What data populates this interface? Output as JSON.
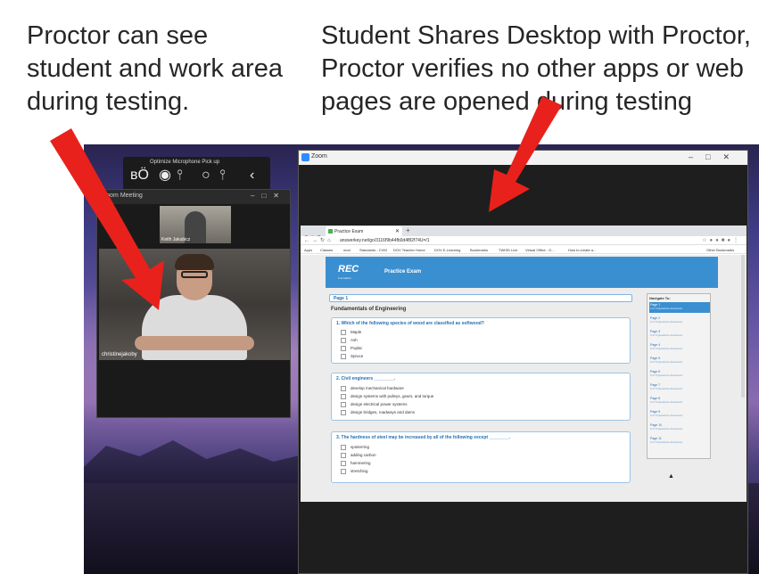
{
  "captions": {
    "left": "Proctor can see student and work area during testing.",
    "right": "Student Shares Desktop with Proctor, Proctor verifies no other apps or web pages are opened during testing"
  },
  "mic_toolbar": {
    "title": "Optimize Microphone Pick up"
  },
  "zoom_meeting": {
    "title": "Zoom Meeting",
    "thumbnail_name": "Keith Jakubicz",
    "participant_name": "christinejakoby"
  },
  "zoom_share": {
    "title": "Zoom"
  },
  "browser": {
    "tab_title": "Practice Exam",
    "url": "answerkey.net/go/3116f9b44fb0d4f82f74U=/1",
    "bookmarks": [
      "Apps",
      "Classes",
      "mod",
      "Standards - CVM",
      "DOV Teacher Home",
      "DOV E-Learning",
      "Bookmarks",
      "TWISD Live",
      "Virtual Office - G...",
      "How to create a...",
      "Other Bookmarks"
    ]
  },
  "exam": {
    "logo": "REC",
    "logo_sub": "Foundation",
    "header_title": "Practice Exam",
    "page_label": "Page 1",
    "section_title": "Fundamentals of Engineering",
    "questions": [
      {
        "text": "1.  Which of the following species of wood are classified as softwood?",
        "options": [
          "Maple",
          "Ash",
          "Poplar",
          "Spruce"
        ]
      },
      {
        "text": "2.  Civil engineers ________.",
        "options": [
          "develop mechanical hardware",
          "design systems with pulleys, gears, and torque",
          "design electrical power systems",
          "design bridges, roadways and dams"
        ]
      },
      {
        "text": "3.  The hardness of steel may be increased by all of the following except ________.",
        "options": [
          "spinterring",
          "adding carbon",
          "hammering",
          "stretching"
        ]
      }
    ],
    "navigate": {
      "heading": "Navigate To:",
      "pages": [
        {
          "label": "Page 1",
          "status": "0 of 5 Questions Answered"
        },
        {
          "label": "Page 2",
          "status": "0 of 5 Questions Answered"
        },
        {
          "label": "Page 3",
          "status": "0 of 4 Questions Answered"
        },
        {
          "label": "Page 4",
          "status": "0 of 5 Questions Answered"
        },
        {
          "label": "Page 5",
          "status": "0 of 5 Questions Answered"
        },
        {
          "label": "Page 6",
          "status": "0 of 5 Questions Answered"
        },
        {
          "label": "Page 7",
          "status": "0 of 5 Questions Answered"
        },
        {
          "label": "Page 8",
          "status": "0 of 5 Questions Answered"
        },
        {
          "label": "Page 9",
          "status": "0 of 5 Questions Answered"
        },
        {
          "label": "Page 10",
          "status": "0 of 5 Questions Answered"
        },
        {
          "label": "Page 11",
          "status": "0 of 5 Questions Answered"
        }
      ]
    }
  },
  "colors": {
    "arrow": "#e8211c",
    "exam_header": "#3a8fd1",
    "caption_text": "#262626"
  }
}
